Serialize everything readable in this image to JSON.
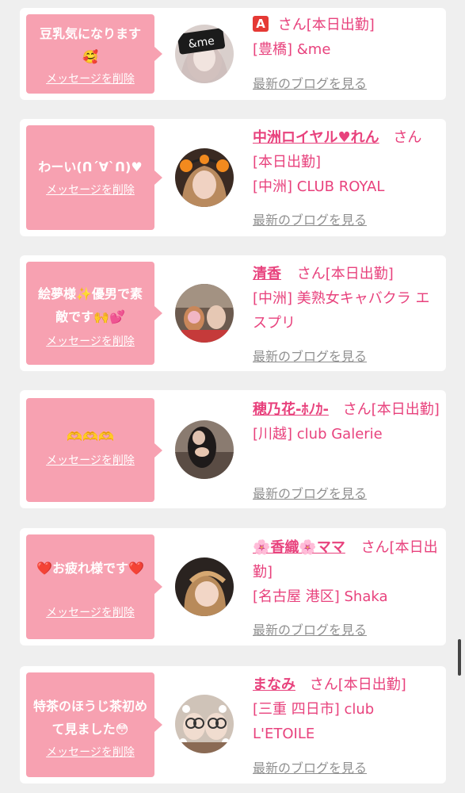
{
  "messages": [
    {
      "bubble_text": "豆乳気になります🥰",
      "delete_label": "メッセージを削除",
      "badge": "A",
      "cast_name": "",
      "honorific": "さん[本日出勤]",
      "shop": "[豊橋] &me",
      "blog_link": "最新のブログを見る",
      "avatar_label": "&me"
    },
    {
      "bubble_text": "わーい(ᑎ´∀`ᑎ)♥",
      "delete_label": "メッセージを削除",
      "cast_name": "中洲ロイヤル♥れん",
      "honorific": "さん[本日出勤]",
      "shop": "[中洲] CLUB ROYAL",
      "blog_link": "最新のブログを見る"
    },
    {
      "bubble_text": "絵夢様✨優男で素敵です🙌💕",
      "delete_label": "メッセージを削除",
      "cast_name": "清香",
      "honorific": "さん[本日出勤]",
      "shop": "[中洲] 美熟女キャバクラ エスプリ",
      "blog_link": "最新のブログを見る"
    },
    {
      "bubble_text": "🫶🫶🫶",
      "delete_label": "メッセージを削除",
      "cast_name": "穂乃花-ﾎﾉｶ-",
      "honorific": "さん[本日出勤]",
      "shop": "[川越] club Galerie",
      "blog_link": "最新のブログを見る"
    },
    {
      "bubble_text": "❤️お疲れ様です❤️",
      "delete_label": "メッセージを削除",
      "cast_name": "🌸香織🌸ママ",
      "honorific": "さん[本日出勤]",
      "shop": "[名古屋 港区] Shaka",
      "blog_link": "最新のブログを見る"
    },
    {
      "bubble_text": "特茶のほうじ茶初めて見ました😳",
      "delete_label": "メッセージを削除",
      "cast_name": "まなみ",
      "honorific": "さん[本日出勤]",
      "shop": "[三重 四日市] club L'ETOILE",
      "blog_link": "最新のブログを見る"
    }
  ],
  "colors": {
    "page_background": "#efefef",
    "bubble": "#f7a1b1",
    "accent_pink": "#e8427d",
    "link_gray": "#909090",
    "badge_red": "#e53935"
  }
}
